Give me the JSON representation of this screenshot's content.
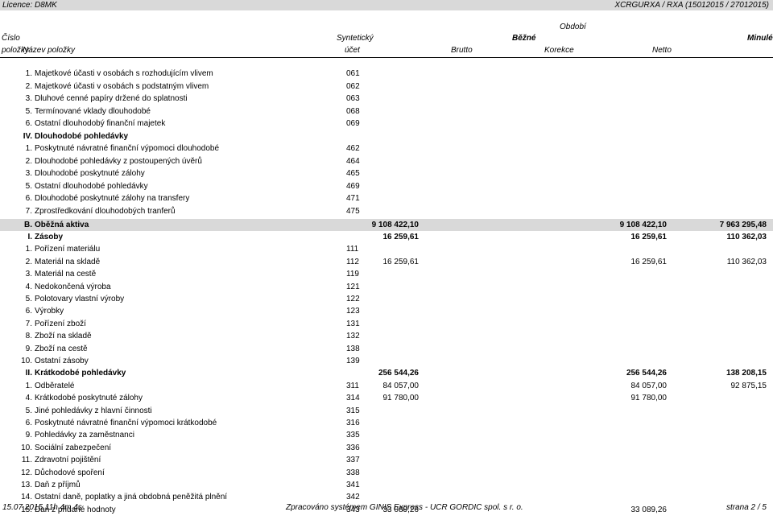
{
  "topbar": {
    "licence": "Licence: D8MK",
    "report": "XCRGURXA / RXA  (15012015 / 27012015)"
  },
  "header": {
    "obdobi": "Období",
    "cislo": "Číslo",
    "polozky": "položky",
    "nazev": "Název položky",
    "synteticky": "Syntetický",
    "ucet": "účet",
    "bezne": "Běžné",
    "minule": "Minulé",
    "brutto": "Brutto",
    "korekce": "Korekce",
    "netto": "Netto"
  },
  "rows": [
    {
      "num": "1.",
      "name": "Majetkové účasti v osobách s rozhodujícím vlivem",
      "acc": "061",
      "bold": false,
      "gray": false
    },
    {
      "num": "2.",
      "name": "Majetkové účasti v osobách s podstatným vlivem",
      "acc": "062",
      "bold": false,
      "gray": false
    },
    {
      "num": "3.",
      "name": "Dluhové cenné papíry držené do splatnosti",
      "acc": "063",
      "bold": false,
      "gray": false
    },
    {
      "num": "5.",
      "name": "Termínované vklady dlouhodobé",
      "acc": "068",
      "bold": false,
      "gray": false
    },
    {
      "num": "6.",
      "name": "Ostatní dlouhodobý finanční majetek",
      "acc": "069",
      "bold": false,
      "gray": false
    },
    {
      "num": "IV.",
      "name": "Dlouhodobé pohledávky",
      "acc": "",
      "bold": true,
      "gray": false
    },
    {
      "num": "1.",
      "name": "Poskytnuté návratné finanční výpomoci dlouhodobé",
      "acc": "462",
      "bold": false,
      "gray": false
    },
    {
      "num": "2.",
      "name": "Dlouhodobé pohledávky z postoupených úvěrů",
      "acc": "464",
      "bold": false,
      "gray": false
    },
    {
      "num": "3.",
      "name": "Dlouhodobé poskytnuté zálohy",
      "acc": "465",
      "bold": false,
      "gray": false
    },
    {
      "num": "5.",
      "name": "Ostatní dlouhodobé pohledávky",
      "acc": "469",
      "bold": false,
      "gray": false
    },
    {
      "num": "6.",
      "name": "Dlouhodobé poskytnuté zálohy na transfery",
      "acc": "471",
      "bold": false,
      "gray": false
    },
    {
      "num": "7.",
      "name": "Zprostředkování dlouhodobých tranferů",
      "acc": "475",
      "bold": false,
      "gray": false
    },
    {
      "num": "B.",
      "name": "Oběžná aktiva",
      "acc": "",
      "v1": "9 108 422,10",
      "v3": "9 108 422,10",
      "v5": "7 963 295,48",
      "bold": true,
      "gray": true
    },
    {
      "num": "I.",
      "name": "Zásoby",
      "acc": "",
      "v1": "16 259,61",
      "v3": "16 259,61",
      "v5": "110 362,03",
      "bold": true,
      "gray": false
    },
    {
      "num": "1.",
      "name": "Pořízení materiálu",
      "acc": "111",
      "bold": false,
      "gray": false
    },
    {
      "num": "2.",
      "name": "Materiál na skladě",
      "acc": "112",
      "v1": "16 259,61",
      "v3": "16 259,61",
      "v5": "110 362,03",
      "bold": false,
      "gray": false
    },
    {
      "num": "3.",
      "name": "Materiál na cestě",
      "acc": "119",
      "bold": false,
      "gray": false
    },
    {
      "num": "4.",
      "name": "Nedokončená výroba",
      "acc": "121",
      "bold": false,
      "gray": false
    },
    {
      "num": "5.",
      "name": "Polotovary vlastní výroby",
      "acc": "122",
      "bold": false,
      "gray": false
    },
    {
      "num": "6.",
      "name": "Výrobky",
      "acc": "123",
      "bold": false,
      "gray": false
    },
    {
      "num": "7.",
      "name": "Pořízení zboží",
      "acc": "131",
      "bold": false,
      "gray": false
    },
    {
      "num": "8.",
      "name": "Zboží na skladě",
      "acc": "132",
      "bold": false,
      "gray": false
    },
    {
      "num": "9.",
      "name": "Zboží na cestě",
      "acc": "138",
      "bold": false,
      "gray": false
    },
    {
      "num": "10.",
      "name": "Ostatní zásoby",
      "acc": "139",
      "bold": false,
      "gray": false
    },
    {
      "num": "II.",
      "name": "Krátkodobé pohledávky",
      "acc": "",
      "v1": "256 544,26",
      "v3": "256 544,26",
      "v5": "138 208,15",
      "bold": true,
      "gray": false
    },
    {
      "num": "1.",
      "name": "Odběratelé",
      "acc": "311",
      "v1": "84 057,00",
      "v3": "84 057,00",
      "v5": "92 875,15",
      "bold": false,
      "gray": false
    },
    {
      "num": "4.",
      "name": "Krátkodobé poskytnuté zálohy",
      "acc": "314",
      "v1": "91 780,00",
      "v3": "91 780,00",
      "bold": false,
      "gray": false
    },
    {
      "num": "5.",
      "name": "Jiné pohledávky z hlavní činnosti",
      "acc": "315",
      "bold": false,
      "gray": false
    },
    {
      "num": "6.",
      "name": "Poskytnuté návratné finanční výpomoci krátkodobé",
      "acc": "316",
      "bold": false,
      "gray": false
    },
    {
      "num": "9.",
      "name": "Pohledávky za zaměstnanci",
      "acc": "335",
      "bold": false,
      "gray": false
    },
    {
      "num": "10.",
      "name": "Sociální zabezpečení",
      "acc": "336",
      "bold": false,
      "gray": false
    },
    {
      "num": "11.",
      "name": "Zdravotní pojištění",
      "acc": "337",
      "bold": false,
      "gray": false
    },
    {
      "num": "12.",
      "name": "Důchodové spoření",
      "acc": "338",
      "bold": false,
      "gray": false
    },
    {
      "num": "13.",
      "name": "Daň z příjmů",
      "acc": "341",
      "bold": false,
      "gray": false
    },
    {
      "num": "14.",
      "name": "Ostatní daně, poplatky a jiná obdobná peněžitá plnění",
      "acc": "342",
      "bold": false,
      "gray": false
    },
    {
      "num": "15.",
      "name": "Daň z přidané hodnoty",
      "acc": "343",
      "v1": "33 089,26",
      "v3": "33 089,26",
      "bold": false,
      "gray": false
    }
  ],
  "footer": {
    "timestamp": "15.07.2015 11h 4m 4s",
    "system": "Zpracováno systémem GINIS Express - UCR GORDIC spol. s r. o.",
    "page": "strana 2 / 5"
  }
}
